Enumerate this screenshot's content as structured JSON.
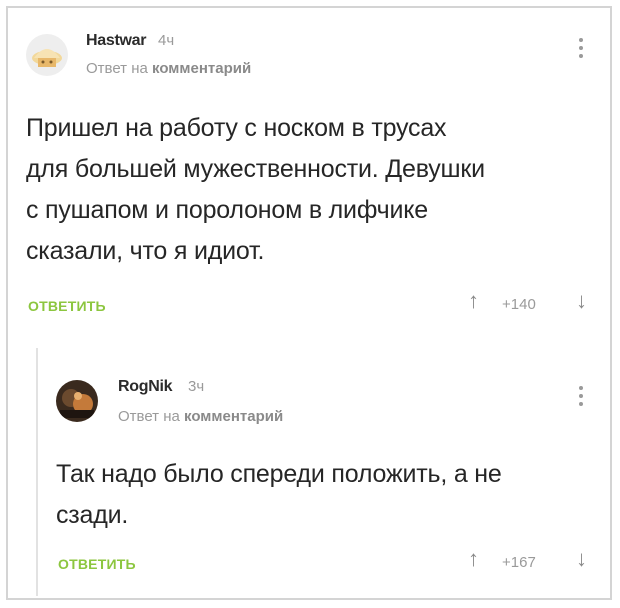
{
  "comments": [
    {
      "username": "Hastwar",
      "time": "4ч",
      "reply_prefix": "Ответ на",
      "reply_word": "комментарий",
      "text_lines": [
        "Пришел на работу с носком в трусах",
        "для большей мужественности. Девушки",
        "с пушапом и поролоном в лифчике",
        "сказали, что я идиот."
      ],
      "reply_label": "ОТВЕТИТЬ",
      "score": "+140",
      "up_icon": "arrow-up-icon",
      "down_icon": "arrow-down-icon"
    },
    {
      "username": "RogNik",
      "time": "3ч",
      "reply_prefix": "Ответ на",
      "reply_word": "комментарий",
      "text_lines": [
        "Так надо было спереди положить, а не",
        "сзади."
      ],
      "reply_label": "ОТВЕТИТЬ",
      "score": "+167"
    }
  ],
  "colors": {
    "accent_green": "#8cc63f",
    "text": "#262626",
    "muted": "#9a9a9a"
  }
}
